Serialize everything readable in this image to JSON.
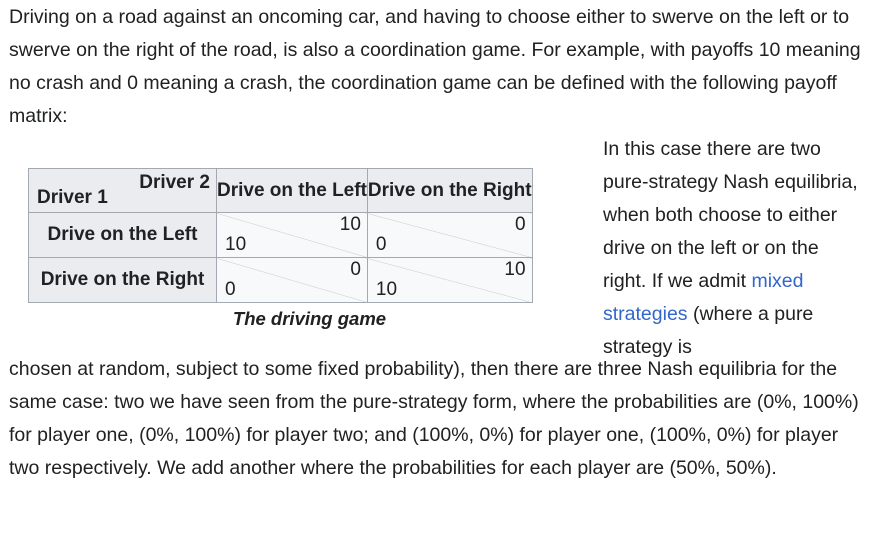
{
  "intro_paragraph": "Driving on a road against an oncoming car, and having to choose either to swerve on the left or to swerve on the right of the road, is also a coordination game. For example, with payoffs 10 meaning no crash and 0 meaning a crash, the coordination game can be defined with the following payoff matrix:",
  "payoff_table": {
    "corner_col_player": "Driver 2",
    "corner_row_player": "Driver 1",
    "columns": [
      "Drive on the Left",
      "Drive on the Right"
    ],
    "rows": [
      {
        "label": "Drive on the Left",
        "cells": [
          {
            "p1": "10",
            "p2": "10"
          },
          {
            "p1": "0",
            "p2": "0"
          }
        ]
      },
      {
        "label": "Drive on the Right",
        "cells": [
          {
            "p1": "0",
            "p2": "0"
          },
          {
            "p1": "10",
            "p2": "10"
          }
        ]
      }
    ],
    "caption": "The driving game"
  },
  "side_text": {
    "before_link": "In this case there are two pure-strategy Nash equilibria, when both choose to either drive on the left or on the right. If we admit",
    "link": "mixed strategies",
    "after_link": "(where a pure strategy is"
  },
  "outro_paragraph": "chosen at random, subject to some fixed probability), then there are three Nash equilibria for the same case: two we have seen from the pure-strategy form, where the probabilities are (0%, 100%) for player one, (0%, 100%) for player two; and (100%, 0%) for player one, (100%, 0%) for player two respectively. We add another where the probabilities for each player are (50%, 50%).",
  "colors": {
    "text": "#202122",
    "link": "#3366cc",
    "table_border": "#a2a9b1",
    "header_bg": "#eaecf0"
  }
}
